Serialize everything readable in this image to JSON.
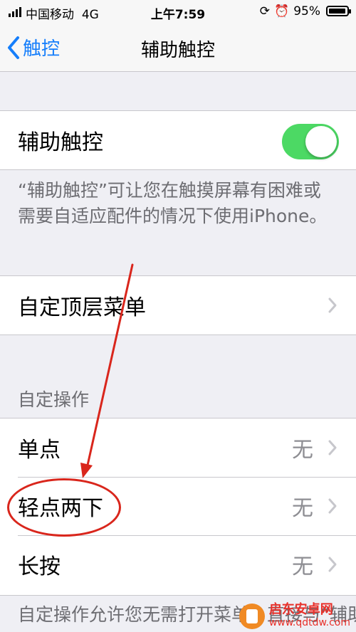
{
  "status_bar": {
    "carrier": "中国移动",
    "network": "4G",
    "time": "上午7:59",
    "battery_percent": "95%",
    "battery_level": 0.95
  },
  "nav": {
    "back_label": "触控",
    "title": "辅助触控"
  },
  "assistive_touch": {
    "label": "辅助触控",
    "enabled": true,
    "footer": "“辅助触控”可让您在触摸屏幕有困难或需要自适应配件的情况下使用iPhone。"
  },
  "top_menu": {
    "label": "自定顶层菜单"
  },
  "custom_actions": {
    "header": "自定操作",
    "items": [
      {
        "label": "单点",
        "value": "无"
      },
      {
        "label": "轻点两下",
        "value": "无"
      },
      {
        "label": "长按",
        "value": "无"
      }
    ],
    "footer": "自定操作允许您无需打开菜单，直接与“辅助触控”图标交互"
  },
  "watermark": {
    "name": "启东安卓网",
    "url": "www.qdtdw.com"
  },
  "colors": {
    "accent": "#157efb",
    "toggle_on": "#4cd964",
    "annotation": "#d9261c"
  }
}
